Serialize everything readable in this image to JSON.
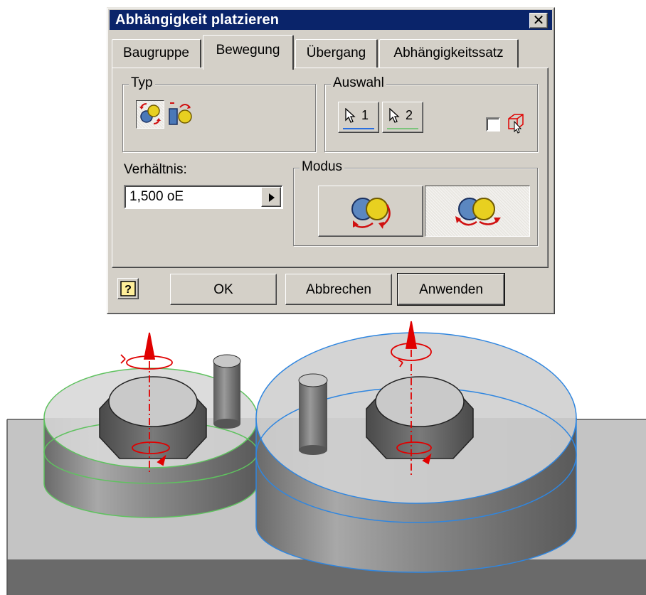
{
  "dialog": {
    "title": "Abhängigkeit platzieren",
    "close_glyph": "✕",
    "tabs": [
      "Baugruppe",
      "Bewegung",
      "Übergang",
      "Abhängigkeitssatz"
    ],
    "active_tab": "Bewegung",
    "typ": {
      "label": "Typ",
      "options": [
        "rotation-icon",
        "rotation-translation-icon"
      ],
      "selected": "rotation-icon"
    },
    "auswahl": {
      "label": "Auswahl",
      "select1": "1",
      "select2": "2",
      "select1_color": "#2a6fe0",
      "select2_color": "#7cc47c",
      "checkbox_checked": false
    },
    "verhaeltnis": {
      "label": "Verhältnis:",
      "value": "1,500 oE"
    },
    "modus": {
      "label": "Modus",
      "options": [
        "forward-mode-icon",
        "reverse-mode-icon"
      ],
      "selected": "reverse-mode-icon"
    },
    "buttons": {
      "ok": "OK",
      "cancel": "Abbrechen",
      "apply": "Anwenden"
    }
  },
  "scene": {
    "colors": {
      "gear1_edge": "#5fc25f",
      "gear2_edge": "#2f86e0",
      "axis": "#e00000"
    }
  }
}
